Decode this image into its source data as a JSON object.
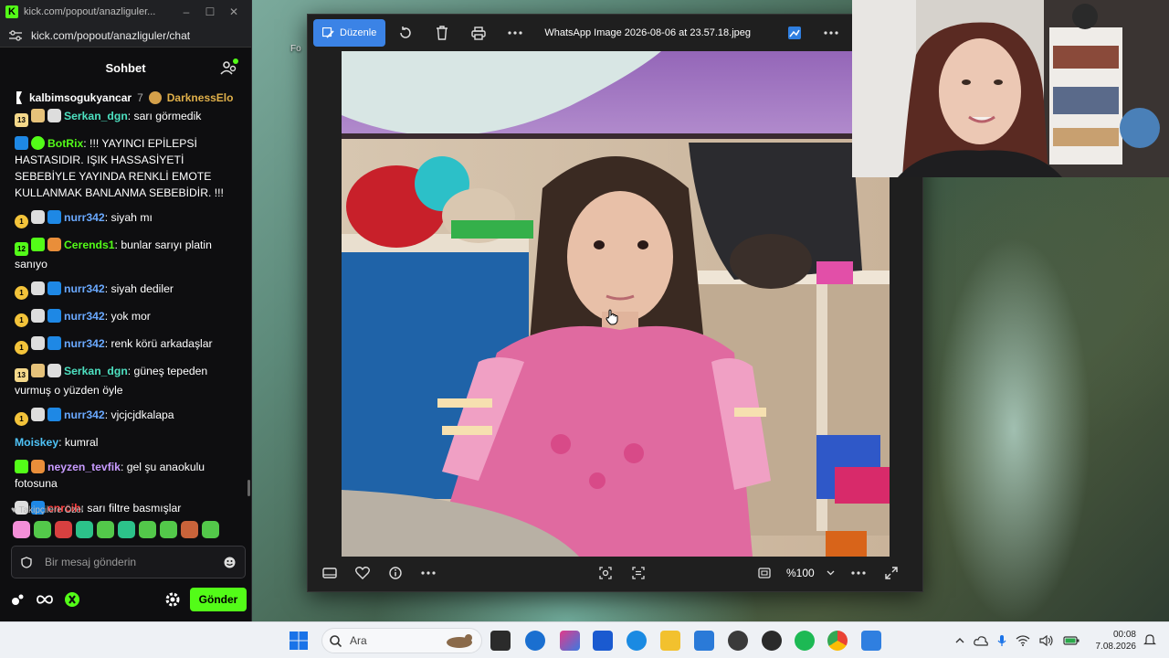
{
  "browser": {
    "tab_url_short": "kick.com/popout/anazliguler...",
    "address": "kick.com/popout/anazliguler/chat"
  },
  "chat": {
    "title": "Sohbet",
    "pinned": {
      "user1": "kalbimsogukyancar",
      "user1_count": "7",
      "user2": "DarknessElo"
    },
    "messages": [
      {
        "user": "Serkan_dgn",
        "text": ": sarı görmedik",
        "color": "c-teal",
        "badges": [
          "b-sub13:13",
          "b-gift:",
          "b-cat:"
        ]
      },
      {
        "user": "BotRix",
        "text": ": !!! YAYINCI EPİLEPSİ HASTASIDIR. IŞIK HASSASİYETİ SEBEBİYLE YAYINDA RENKLİ EMOTE KULLANMAK BANLANMA SEBEBİDİR. !!!",
        "color": "c-green",
        "badges": [
          "b-mod:",
          "b-verified:"
        ]
      },
      {
        "user": "nurr342",
        "text": ": siyah mı",
        "color": "c-blue",
        "badges": [
          "b-gold:1",
          "b-cat:",
          "b-mod:"
        ]
      },
      {
        "user": "Cerends1",
        "text": ": bunlar sarıyı platin sanıyo",
        "color": "c-green",
        "badges": [
          "b-sub12:12",
          "b-green:",
          "b-cat2:"
        ]
      },
      {
        "user": "nurr342",
        "text": ": siyah dediler",
        "color": "c-blue",
        "badges": [
          "b-gold:1",
          "b-cat:",
          "b-mod:"
        ]
      },
      {
        "user": "nurr342",
        "text": ": yok mor",
        "color": "c-blue",
        "badges": [
          "b-gold:1",
          "b-cat:",
          "b-mod:"
        ]
      },
      {
        "user": "nurr342",
        "text": ": renk körü arkadaşlar",
        "color": "c-blue",
        "badges": [
          "b-gold:1",
          "b-cat:",
          "b-mod:"
        ]
      },
      {
        "user": "Serkan_dgn",
        "text": ": güneş tepeden vurmuş o yüzden öyle",
        "color": "c-teal",
        "badges": [
          "b-sub13:13",
          "b-gift:",
          "b-cat:"
        ]
      },
      {
        "user": "nurr342",
        "text": ": vjcjcjdkalapa",
        "color": "c-blue",
        "badges": [
          "b-gold:1",
          "b-cat:",
          "b-mod:"
        ]
      },
      {
        "user": "Moiskey",
        "text": ": kumral",
        "color": "c-cyan",
        "badges": []
      },
      {
        "user": "neyzen_tevfik",
        "text": ": gel şu anaokulu fotosuna",
        "color": "c-purple",
        "badges": [
          "b-green:",
          "b-cat2:"
        ]
      },
      {
        "user": "cnrcih",
        "text": ": sarı filtre basmışlar",
        "color": "c-red",
        "badges": [
          "b-cat:",
          "b-mod:"
        ]
      }
    ],
    "followers_only_label": "Takipçilere Özel",
    "emote_colors": [
      "#f48fd8",
      "#53c84a",
      "#d84040",
      "#2cc28a",
      "#53c84a",
      "#2cc28a",
      "#53c84a",
      "#53c84a",
      "#c8633a",
      "#53c84a"
    ],
    "input_placeholder": "Bir mesaj gönderin",
    "send_label": "Gönder"
  },
  "viewer": {
    "edit_label": "Düzenle",
    "file_name": "WhatsApp Image 2026-08-06 at 23.57.18.jpeg",
    "zoom": "%100"
  },
  "taskbar": {
    "search_placeholder": "Ara",
    "time": "00:08",
    "date": "7.08.2026"
  },
  "colors": {
    "kick_green": "#53fc18",
    "accent_blue": "#3b83e6"
  }
}
